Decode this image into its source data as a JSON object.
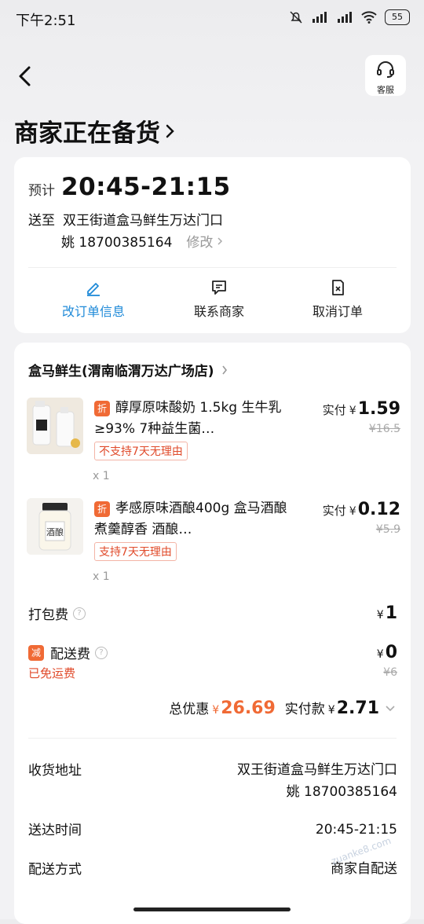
{
  "status_bar": {
    "time": "下午2:51",
    "battery": "55"
  },
  "header": {
    "cs_label": "客服",
    "title": "商家正在备货"
  },
  "delivery": {
    "eta_prefix": "预计",
    "eta_time": "20:45-21:15",
    "address_prefix": "送至",
    "address": "双王街道盒马鲜生万达门口",
    "contact": "姚 18700385164",
    "modify": "修改"
  },
  "actions": [
    {
      "label": "改订单信息",
      "icon": "edit-icon"
    },
    {
      "label": "联系商家",
      "icon": "chat-icon"
    },
    {
      "label": "取消订单",
      "icon": "cancel-order-icon"
    }
  ],
  "store": {
    "name": "盒马鲜生(渭南临渭万达广场店)"
  },
  "products": [
    {
      "tag": "折",
      "name": "醇厚原味酸奶 1.5kg 生牛乳≥93% 7种益生菌…",
      "return_policy": "不支持7天无理由",
      "qty": "x 1",
      "price_prefix": "实付",
      "currency": "¥",
      "price": "1.59",
      "original_price": "¥16.5"
    },
    {
      "tag": "折",
      "name": "孝感原味酒酿400g 盒马酒酿 煮羹醇香 酒酿…",
      "return_policy": "支持7天无理由",
      "qty": "x 1",
      "price_prefix": "实付",
      "currency": "¥",
      "price": "0.12",
      "original_price": "¥5.9"
    }
  ],
  "fees": {
    "packing_label": "打包费",
    "packing_value": "1",
    "delivery_tag": "减",
    "delivery_label": "配送费",
    "delivery_value": "0",
    "delivery_original": "¥6",
    "free_shipping": "已免运费",
    "currency": "¥"
  },
  "totals": {
    "discount_label": "总优惠",
    "discount_value": "26.69",
    "paid_label": "实付款",
    "paid_value": "2.71",
    "currency": "¥"
  },
  "info": {
    "address_label": "收货地址",
    "address_line1": "双王街道盒马鲜生万达门口",
    "address_line2": "姚 18700385164",
    "time_label": "送达时间",
    "time_value": "20:45-21:15",
    "method_label": "配送方式",
    "method_value": "商家自配送"
  },
  "watermark": "zuanke8.com"
}
